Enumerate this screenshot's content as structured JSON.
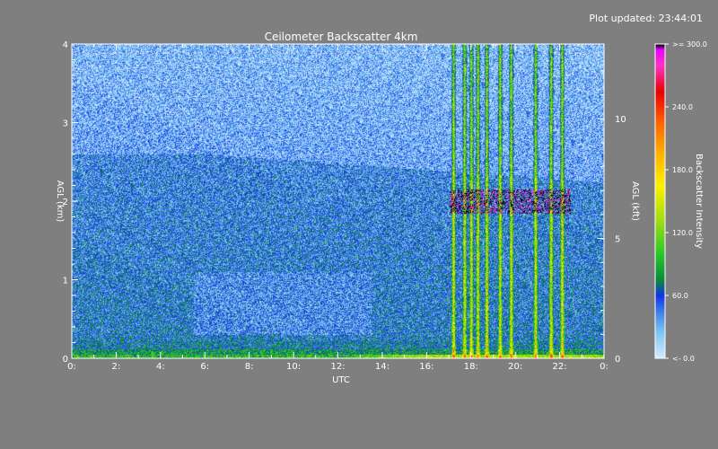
{
  "updated": "Plot updated: 23:44:01",
  "chart_data": {
    "type": "heatmap",
    "title": "Ceilometer Backscatter 4km",
    "xlabel": "UTC",
    "ylabel_left": "AGL (km)",
    "ylabel_right": "AGL (kft)",
    "colorbar_label": "Backscatter Intensity",
    "x_ticks": [
      "0:",
      "2:",
      "4:",
      "6:",
      "8:",
      "10:",
      "12:",
      "14:",
      "16:",
      "18:",
      "20:",
      "22:",
      "0:"
    ],
    "y_ticks_km": [
      "0",
      "1",
      "2",
      "3",
      "4"
    ],
    "y_ticks_kft": [
      "0",
      "5",
      "10"
    ],
    "colorbar_ticks": [
      "<- 0.0",
      "60.0",
      "120.0",
      "180.0",
      "240.0",
      ">= 300.0"
    ],
    "xlim_hours": [
      0,
      24
    ],
    "ylim_km": [
      0,
      4
    ],
    "ylim_kft": [
      0,
      13.12
    ],
    "clim": [
      0,
      300
    ],
    "colorscale": [
      {
        "value": 0,
        "color": "#d6ecff"
      },
      {
        "value": 25,
        "color": "#7ec4f6"
      },
      {
        "value": 45,
        "color": "#3c7fe6"
      },
      {
        "value": 60,
        "color": "#1432e6"
      },
      {
        "value": 75,
        "color": "#0a8a3a"
      },
      {
        "value": 100,
        "color": "#28c828"
      },
      {
        "value": 130,
        "color": "#9bdc14"
      },
      {
        "value": 165,
        "color": "#fff000"
      },
      {
        "value": 195,
        "color": "#ffb400"
      },
      {
        "value": 225,
        "color": "#ff6400"
      },
      {
        "value": 255,
        "color": "#e60000"
      },
      {
        "value": 280,
        "color": "#ff32c8"
      },
      {
        "value": 295,
        "color": "#e600ff"
      },
      {
        "value": 300,
        "color": "#000000"
      }
    ],
    "features": {
      "surface_layer_top_km": 0.3,
      "residual_layer_top_km": 2.6,
      "precip_streaks_utc": [
        17.2,
        17.7,
        18.0,
        18.3,
        18.7,
        19.3,
        19.8,
        20.9,
        21.6,
        22.1
      ],
      "cloud_base_km": 2.0
    }
  }
}
